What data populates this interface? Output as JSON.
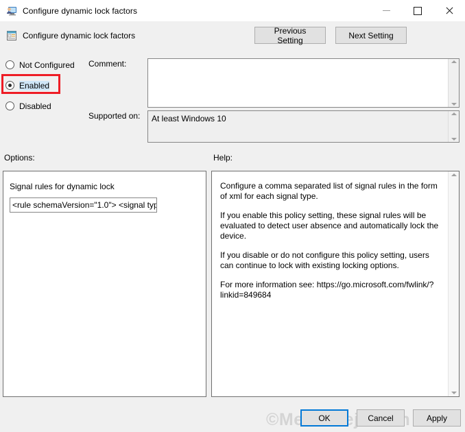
{
  "window": {
    "title": "Configure dynamic lock factors",
    "title_icon": "computer-user-icon",
    "minimize_label": "—",
    "maximize_label": "□",
    "close_label": "✕"
  },
  "header": {
    "policy_name": "Configure dynamic lock factors",
    "policy_icon": "policy-setting-icon",
    "previous_setting": "Previous Setting",
    "next_setting": "Next Setting"
  },
  "state_options": {
    "not_configured": "Not Configured",
    "enabled": "Enabled",
    "disabled": "Disabled",
    "selected": "Enabled",
    "highlight_color": "#ee1c25"
  },
  "comment": {
    "label": "Comment:",
    "value": "",
    "placeholder": ""
  },
  "supported_on": {
    "label": "Supported on:",
    "value": "At least Windows 10"
  },
  "options": {
    "label": "Options:",
    "setting_label": "Signal rules for dynamic lock",
    "setting_value": "<rule schemaVersion=\"1.0\"> <signal typ"
  },
  "help": {
    "label": "Help:",
    "paragraphs": [
      "Configure a comma separated list of signal rules in the form of xml for each signal type.",
      "If you enable this policy setting, these signal rules will be evaluated to detect user absence and automatically lock the device.",
      "If you disable or do not configure this policy setting, users can continue to lock with existing locking options.",
      "For more information see: https://go.microsoft.com/fwlink/?linkid=849684"
    ]
  },
  "footer": {
    "ok": "OK",
    "cancel": "Cancel",
    "apply": "Apply"
  },
  "watermark": {
    "text": "©MeraBheja.com"
  }
}
